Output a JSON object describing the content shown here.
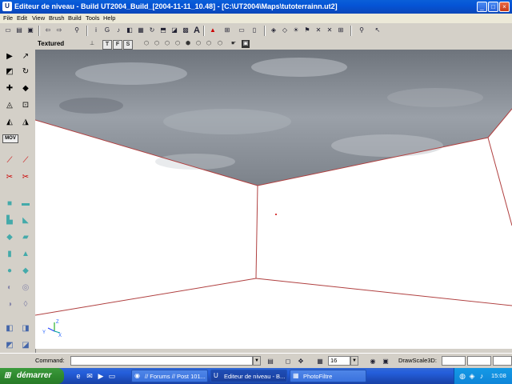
{
  "window": {
    "app_icon": "U",
    "title": "Editeur de niveau - Build UT2004_Build_[2004-11-11_10.48] - [C:\\UT2004\\Maps\\tutoterrainn.ut2]"
  },
  "menu": [
    "File",
    "Edit",
    "View",
    "Brush",
    "Build",
    "Tools",
    "Help"
  ],
  "viewport": {
    "title": "Textured",
    "mode_buttons": [
      "T",
      "F",
      "S"
    ],
    "axis_labels": {
      "z": "Z",
      "y": "Y",
      "x": "X"
    },
    "colors": {
      "brush_line": "#b04040",
      "sky": "#8b9098"
    }
  },
  "command_bar": {
    "command_label": "Command:",
    "command_value": "",
    "grid_value": "16",
    "drawscale_label": "DrawScale3D:",
    "drawscale_x": "",
    "drawscale_y": "",
    "drawscale_z": ""
  },
  "taskbar": {
    "start_label": "démarrer",
    "tasks": [
      {
        "label": "// Forums // Post 101...",
        "icon": "browser-icon"
      },
      {
        "label": "Editeur de niveau - B...",
        "icon": "unreal-editor-icon",
        "active": true
      },
      {
        "label": "PhotoFiltre",
        "icon": "photofiltre-icon"
      }
    ],
    "clock": "15:08"
  }
}
